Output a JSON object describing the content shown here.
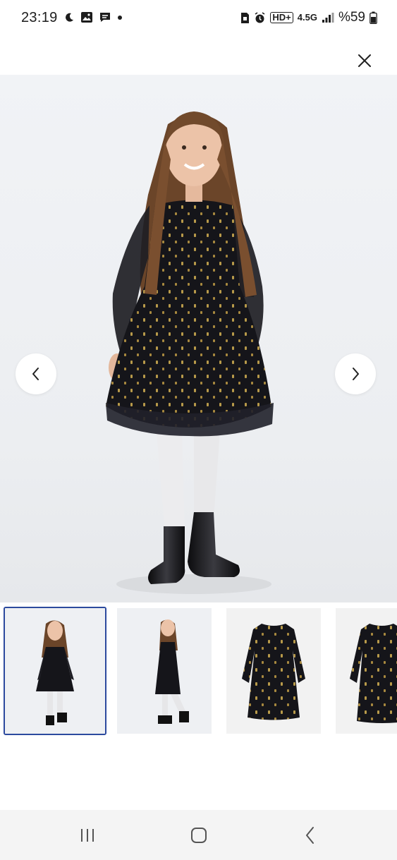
{
  "status_bar": {
    "time": "23:19",
    "battery_text": "%59",
    "network_label": "4.5G",
    "hd_label": "HD+"
  },
  "icons": {
    "close": "close-icon",
    "prev": "chevron-left-icon",
    "next": "chevron-right-icon"
  },
  "gallery": {
    "selected_index": 0,
    "thumbnails": [
      {
        "kind": "model-front"
      },
      {
        "kind": "model-side"
      },
      {
        "kind": "product-front"
      },
      {
        "kind": "product-back"
      }
    ]
  },
  "colors": {
    "selected_border": "#2c4a9e",
    "dress": "#15151a",
    "dot_gold": "#b89a4a"
  }
}
